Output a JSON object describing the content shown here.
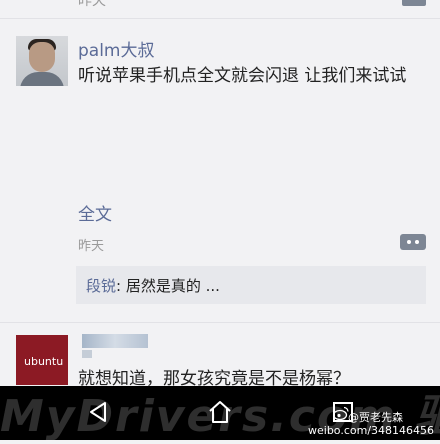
{
  "previous_post": {
    "time": "昨天"
  },
  "post": {
    "username": "palm大叔",
    "text": "听说苹果手机点全文就会闪退 让我们来试试",
    "fulltext_label": "全文",
    "time": "昨天",
    "comment": {
      "author": "段锐",
      "text": ": 居然是真的 ..."
    }
  },
  "next_post": {
    "avatar_text": "ubuntu",
    "text": "就想知道，那女孩究竟是不是杨幂？"
  },
  "overlay": {
    "watermark": "MyDrivers.com 驱动之家",
    "weibo_account": "@贾老先森",
    "weibo_url": "weibo.com/348146456"
  },
  "nav": {
    "icons": [
      "back-icon",
      "home-icon",
      "recent-apps-icon"
    ]
  },
  "colors": {
    "link": "#5b6b97",
    "background": "#f2f2f4",
    "comment_bg": "#e7e8ec",
    "navbar": "#000000"
  }
}
